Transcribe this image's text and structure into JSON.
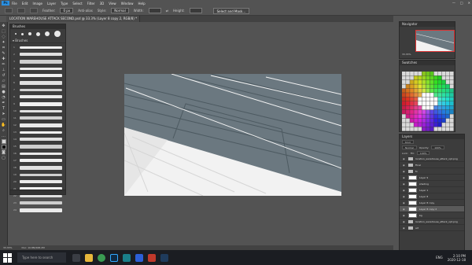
{
  "menu": {
    "app_logo": "Ps",
    "items": [
      "File",
      "Edit",
      "Image",
      "Layer",
      "Type",
      "Select",
      "Filter",
      "3D",
      "View",
      "Window",
      "Help"
    ],
    "window_controls": [
      "—",
      "□",
      "✕"
    ]
  },
  "options": {
    "feather_label": "Feather:",
    "feather_value": "0 px",
    "antialias_label": "Anti-alias",
    "style_label": "Style:",
    "style_value": "Normal",
    "width_label": "Width:",
    "height_label": "Height:",
    "mask_button": "Select and Mask..."
  },
  "document": {
    "tab_title": "LOCATION WAREHOUSE ATTACK SECOND.psd @ 33.3% (Layer 8 copy 2, RGB/8) *"
  },
  "brushes": {
    "title": "Brushes",
    "folder": "Brushes",
    "rows": [
      "1",
      "2",
      "3",
      "4",
      "5",
      "6",
      "7",
      "8",
      "9",
      "10",
      "11",
      "12",
      "13",
      "14",
      "15",
      "16",
      "17",
      "18",
      "19",
      "20",
      "21",
      "22",
      "23",
      "24",
      "25"
    ]
  },
  "navigator": {
    "title": "Navigator",
    "zoom": "33.33%"
  },
  "swatches": {
    "title": "Swatches"
  },
  "layers": {
    "title": "Layers",
    "kind_label": "Kind",
    "blend_mode": "Normal",
    "opacity_label": "Opacity:",
    "opacity_value": "100%",
    "lock_label": "Lock:",
    "fill_label": "Fill:",
    "fill_value": "100%",
    "rows": [
      {
        "name": "location_warehouse_attack_opt.png",
        "type": "folder",
        "selected": false
      },
      {
        "name": "Final",
        "type": "folder",
        "selected": false
      },
      {
        "name": "fx",
        "type": "folder",
        "selected": false
      },
      {
        "name": "Layer 9",
        "type": "layer",
        "selected": false
      },
      {
        "name": "shading",
        "type": "layer",
        "selected": false
      },
      {
        "name": "Layer 1",
        "type": "layer",
        "selected": false
      },
      {
        "name": "Layer 8",
        "type": "layer",
        "selected": false
      },
      {
        "name": "Layer 8 copy",
        "type": "layer",
        "selected": false
      },
      {
        "name": "Layer 8 copy 2",
        "type": "layer",
        "selected": true
      },
      {
        "name": "bg",
        "type": "layer",
        "selected": false
      },
      {
        "name": "location_warehouse_attack_opt.png",
        "type": "folder",
        "selected": false
      },
      {
        "name": "art",
        "type": "folder",
        "selected": false
      }
    ]
  },
  "status": {
    "zoom": "33.33%",
    "doc_size": "Doc: 10.8M/168.2M"
  },
  "taskbar": {
    "search_placeholder": "Type here to search",
    "language": "ENG",
    "time": "2:10 PM",
    "date": "2020-12-18"
  },
  "colors": {
    "ui_bg": "#535353",
    "panel_bg": "#3c3c3c",
    "canvas_gray": "#6b7880",
    "taskbar": "#1b1d22"
  }
}
